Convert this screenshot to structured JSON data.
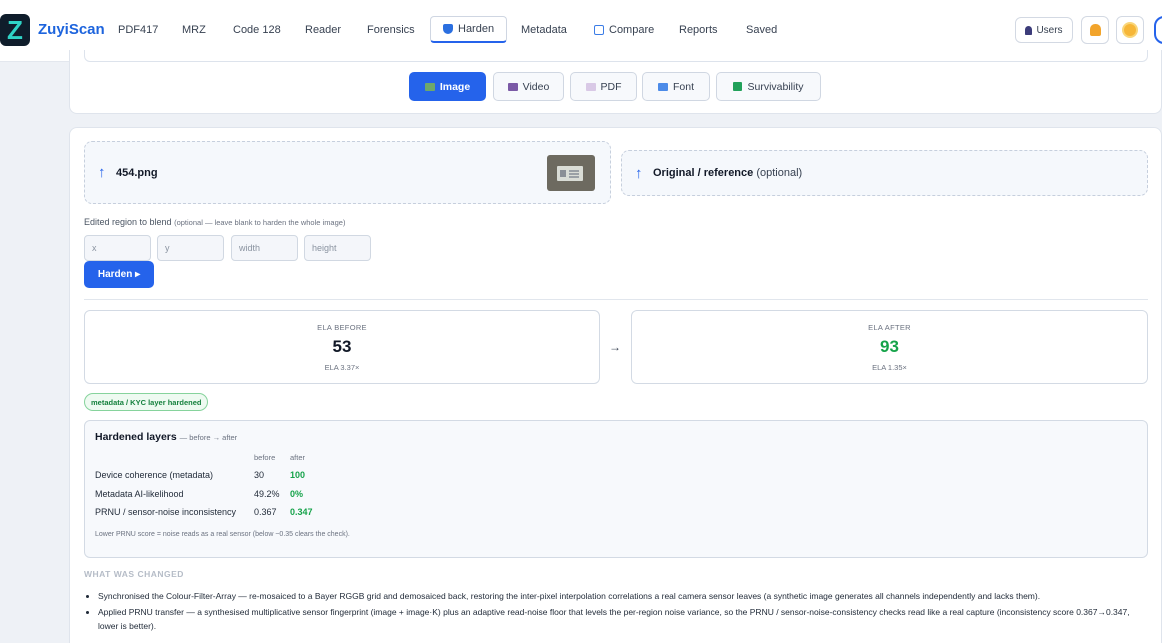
{
  "app": {
    "logo_letter": "Z",
    "brand": "ZuyiScan"
  },
  "nav": {
    "tabs": [
      {
        "label": "PDF417"
      },
      {
        "label": "MRZ"
      },
      {
        "label": "Code 128"
      },
      {
        "label": "Reader"
      },
      {
        "label": "Forensics"
      },
      {
        "label": "Harden"
      },
      {
        "label": "Metadata"
      },
      {
        "label": "Compare"
      },
      {
        "label": "Reports"
      },
      {
        "label": "Saved"
      }
    ],
    "active_tab": "Harden",
    "users_label": "Users"
  },
  "format_tabs": [
    {
      "label": "Image",
      "icon": "image-icon",
      "color": "#6ea86b"
    },
    {
      "label": "Video",
      "icon": "video-icon",
      "color": "#7b5aa6"
    },
    {
      "label": "PDF",
      "icon": "pdf-icon",
      "color": "#d9c9e6"
    },
    {
      "label": "Font",
      "icon": "font-icon",
      "color": "#4c8be8"
    },
    {
      "label": "Survivability",
      "icon": "check-icon",
      "color": "#22a15a"
    }
  ],
  "upload": {
    "file_name": "454.png",
    "reference_label": "Original / reference",
    "reference_hint": "(optional)"
  },
  "region": {
    "label": "Edited region to blend",
    "hint": "(optional — leave blank to harden the whole image)",
    "placeholders": {
      "x": "x",
      "y": "y",
      "width": "width",
      "height": "height"
    },
    "button_label": "Harden ▸"
  },
  "ela": {
    "before": {
      "label": "ELA BEFORE",
      "value": "53",
      "sub": "ELA 3.37×"
    },
    "arrow": "→",
    "after": {
      "label": "ELA AFTER",
      "value": "93",
      "sub": "ELA 1.35×"
    }
  },
  "badge": "metadata / KYC layer hardened",
  "layers": {
    "title": "Hardened layers",
    "subtitle": "— before → after",
    "col_before": "before",
    "col_after": "after",
    "rows": [
      {
        "label": "Device coherence (metadata)",
        "before": "30",
        "after": "100"
      },
      {
        "label": "Metadata AI-likelihood",
        "before": "49.2%",
        "after": "0%"
      },
      {
        "label": "PRNU / sensor-noise inconsistency",
        "before": "0.367",
        "after": "0.347"
      }
    ],
    "footnote": "Lower PRNU score = noise reads as a real sensor (below ~0.35 clears the check)."
  },
  "changes": {
    "heading": "WHAT WAS CHANGED",
    "items": [
      "Synchronised the Colour-Filter-Array — re-mosaiced to a Bayer RGGB grid and demosaiced back, restoring the inter-pixel interpolation correlations a real camera sensor leaves (a synthetic image generates all channels independently and lacks them).",
      "Applied PRNU transfer — a synthesised multiplicative sensor fingerprint (image + image·K) plus an adaptive read-noise floor that levels the per-region noise variance, so the PRNU / sensor-noise-consistency checks read like a real capture (inconsistency score 0.367→0.347, lower is better)."
    ]
  }
}
